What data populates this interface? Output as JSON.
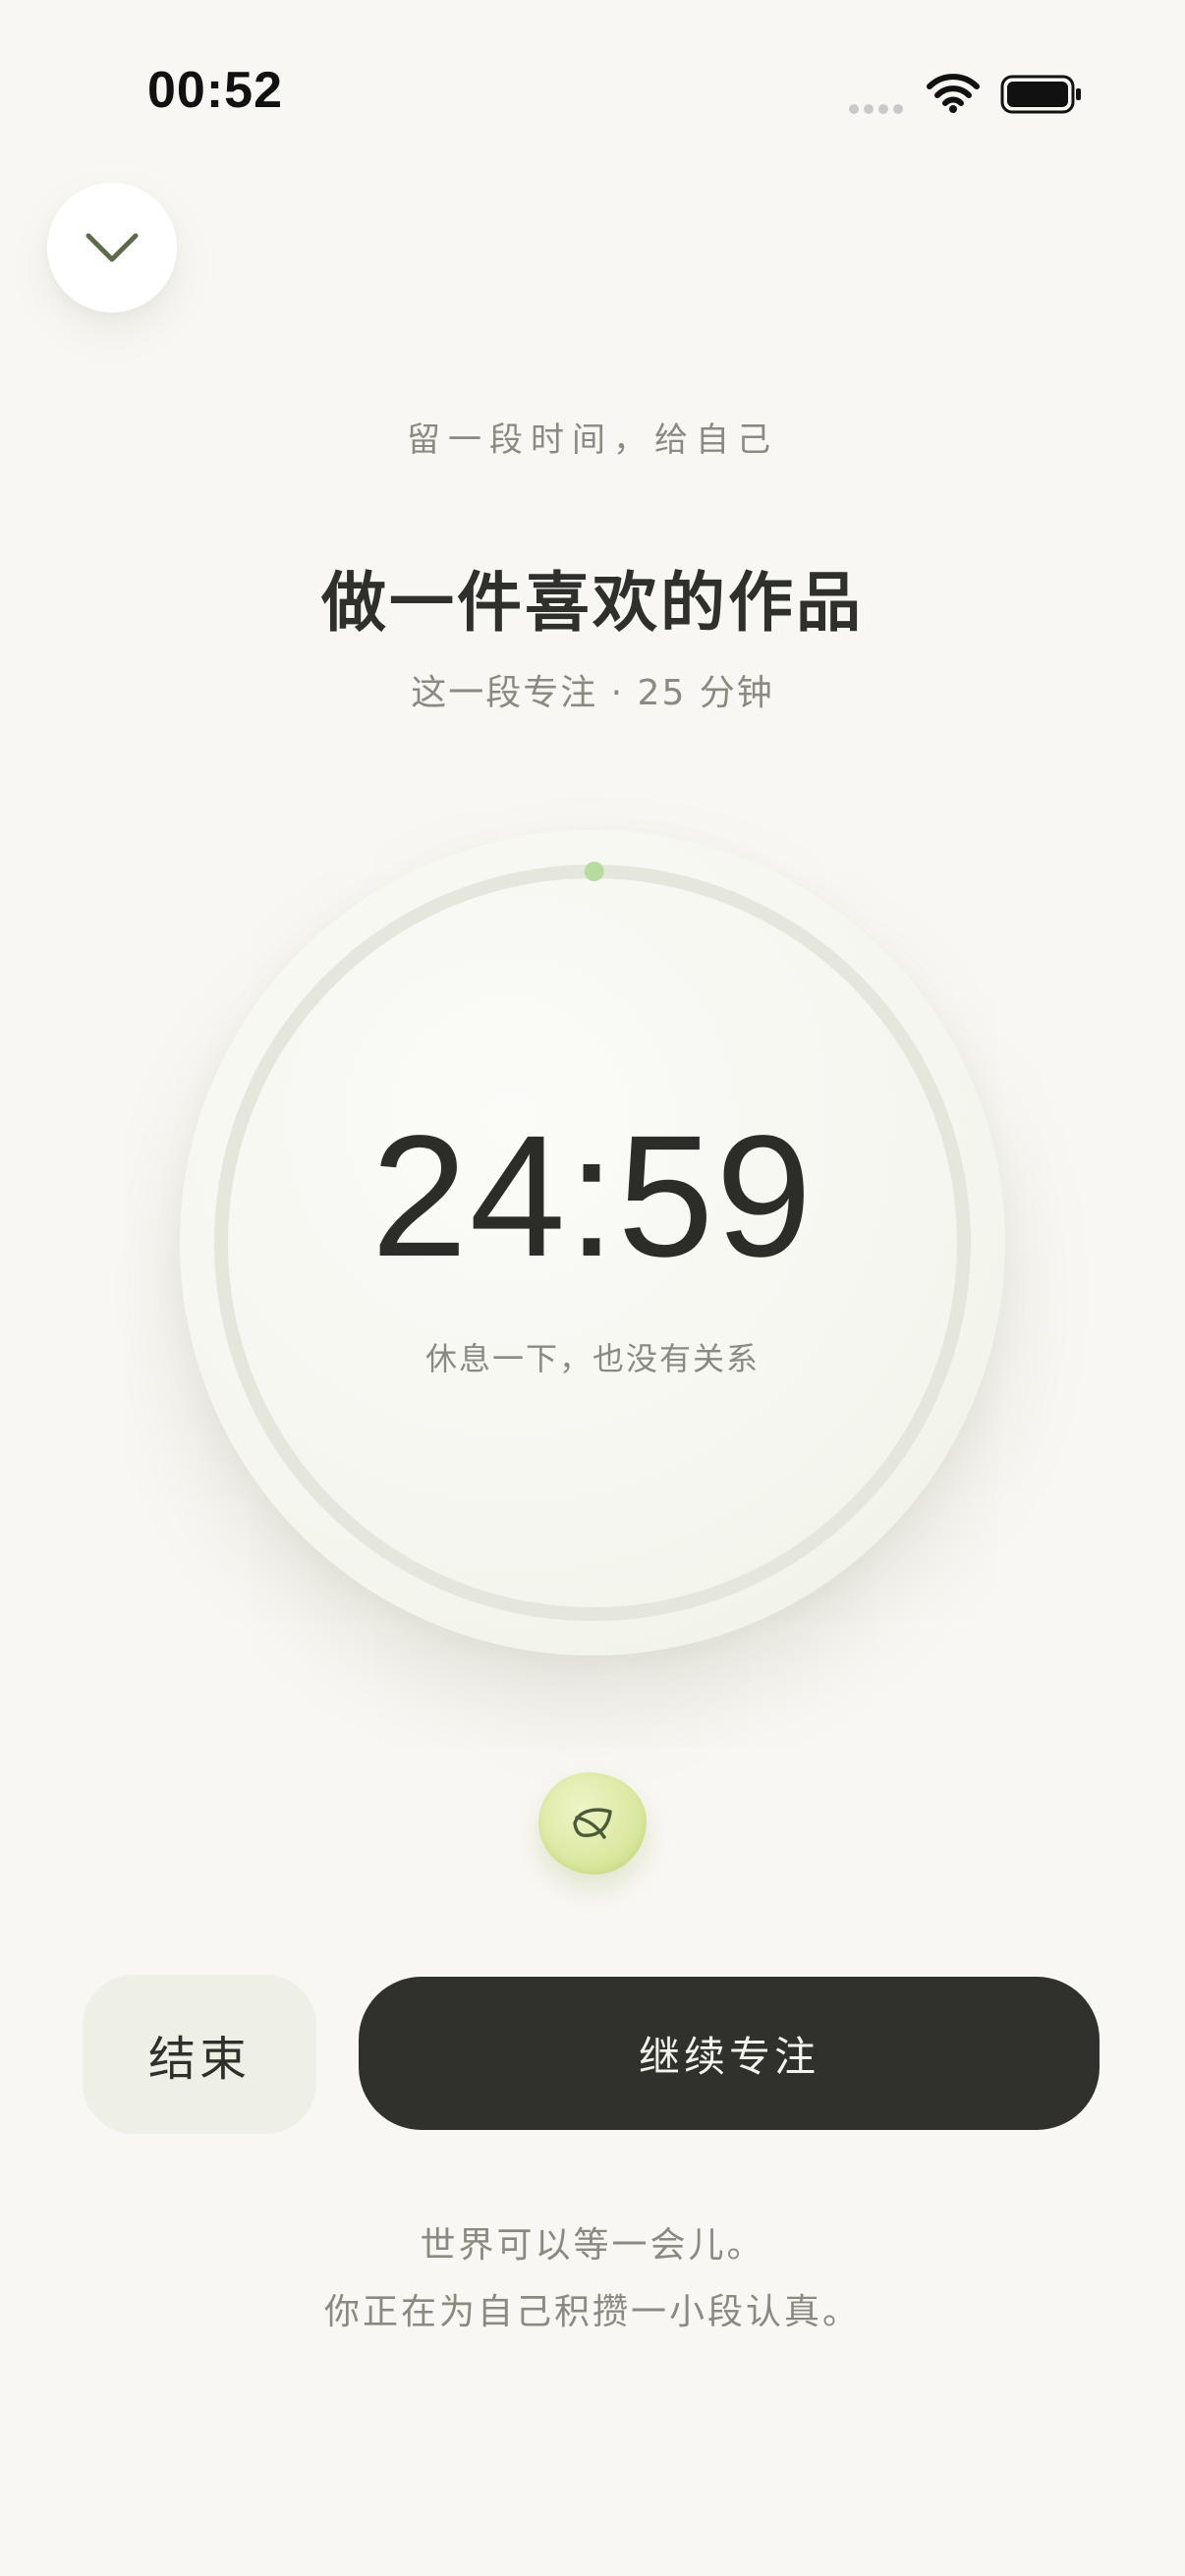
{
  "status_bar": {
    "time": "00:52",
    "icons": [
      "cellular-signal-icon",
      "wifi-icon",
      "battery-icon"
    ]
  },
  "header": {
    "collapse_icon": "chevron-down-icon",
    "tagline": "留一段时间，给自己",
    "task_title": "做一件喜欢的作品",
    "session_info": "这一段专注 · 25 分钟"
  },
  "timer": {
    "remaining": "24:59",
    "hint": "休息一下，也没有关系",
    "total_minutes": 25,
    "elapsed_fraction": 0.0007
  },
  "pebble": {
    "icon": "leaf-icon"
  },
  "actions": {
    "end_label": "结束",
    "continue_label": "继续专注"
  },
  "footer": {
    "quote_line_1": "世界可以等一会儿。",
    "quote_line_2": "你正在为自己积攒一小段认真。"
  },
  "colors": {
    "background": "#f8f7f3",
    "primary_dark": "#30312c",
    "accent_green": "#b8dca0",
    "muted_text": "#8a8a80"
  }
}
